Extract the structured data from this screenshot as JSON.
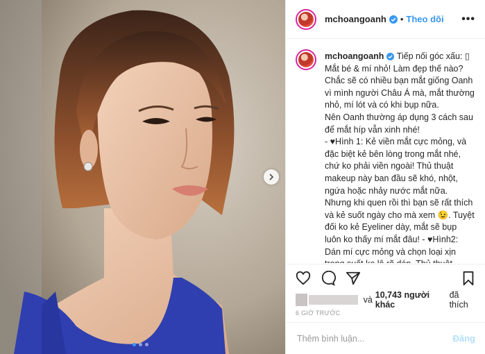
{
  "post": {
    "username": "mchoangoanh",
    "follow_label": "Theo dõi",
    "separator": "•",
    "more_label": "•••",
    "caption": "Tiếp nối góc xấu: ▯\nMắt bé & mí nhỏ! Làm đẹp thế nào?\nChắc sẽ có nhiều bạn mắt giống Oanh vì mình người Châu Á mà, mắt thường nhỏ, mí lót và có khi bụp nữa.\nNên Oanh thường áp dụng 3 cách sau để mắt híp vẫn xinh nhé!\n- ♥Hình 1: Kẻ viền mắt cực mỏng, và đặc biệt kẻ bên lòng trong mắt nhé, chứ ko phải viền ngoài! Thủ thuật makeup này ban đầu sẽ khó, nhột, ngứa hoặc nhảy nước mắt nữa. Nhưng khi quen rồi thì bạn sẽ rất thích và kẻ suốt ngày cho mà xem 😉. Tuyệt đối ko kẻ Eyeliner dày, mắt sẽ bụp luôn ko thấy mí mắt đâu! - ♥Hình2: Dán mí cực mỏng và chọn loại xịn trong suốt ko lộ rõ dán. Thủ thuật makeup này cũng ko dễ ban đầu nhưng tập nhiều",
    "likes_text": "và",
    "likes_count": "10,743 người khác",
    "likes_suffix": "đã thích",
    "time": "6 GIỜ TRƯỚC",
    "comment_placeholder": "Thêm bình luận...",
    "post_label": "Đăng"
  },
  "icons": {
    "verified": "verified-badge-icon",
    "like": "heart-icon",
    "comment": "comment-icon",
    "share": "share-icon",
    "save": "bookmark-icon",
    "next": "chevron-right-icon"
  },
  "colors": {
    "accent": "#3897f0",
    "post_button_disabled": "#b2dffc",
    "dress": "#2f3fb0"
  },
  "carousel": {
    "slide": 1,
    "total": 3
  }
}
